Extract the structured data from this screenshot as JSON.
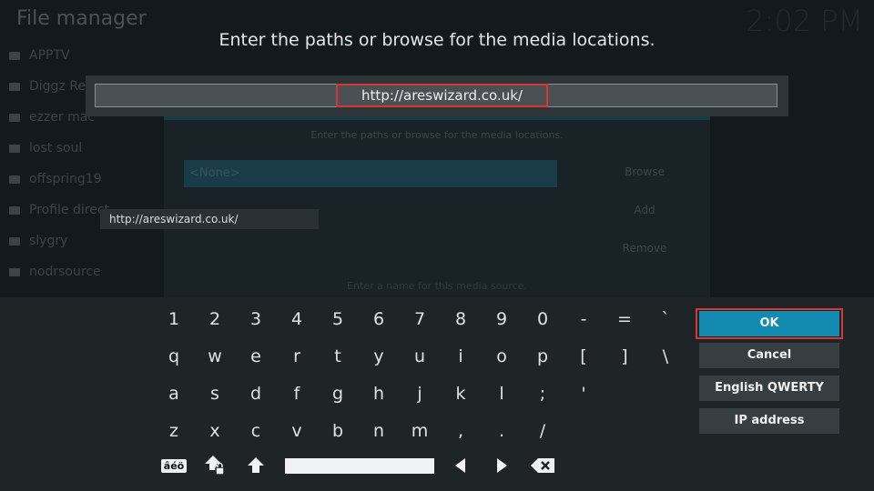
{
  "background": {
    "title": "File manager",
    "clock": "2:02 PM",
    "sources": [
      "APPTV",
      "Diggz Rep",
      "ezzer mac",
      "lost soul",
      "offspring19",
      "Profile direct",
      "slygry",
      "nodrsource"
    ],
    "dialog": {
      "subtitle": "Enter the paths or browse for the media locations.",
      "path_value": "<None>",
      "browse_label": "Browse",
      "add_label": "Add",
      "remove_label": "Remove",
      "name_prompt": "Enter a name for this media source."
    }
  },
  "keyboard_dialog": {
    "heading": "Enter the paths or browse for the media locations.",
    "input_value": "http://areswizard.co.uk/",
    "autocomplete": "http://areswizard.co.uk/",
    "rows": [
      [
        "1",
        "2",
        "3",
        "4",
        "5",
        "6",
        "7",
        "8",
        "9",
        "0",
        "-",
        "=",
        "`"
      ],
      [
        "q",
        "w",
        "e",
        "r",
        "t",
        "y",
        "u",
        "i",
        "o",
        "p",
        "[",
        "]",
        "\\"
      ],
      [
        "a",
        "s",
        "d",
        "f",
        "g",
        "h",
        "j",
        "k",
        "l",
        ";",
        "'"
      ],
      [
        "z",
        "x",
        "c",
        "v",
        "b",
        "n",
        "m",
        ",",
        ".",
        "/"
      ]
    ],
    "special_keys": {
      "symbols_label": "âéö",
      "caps_lock_icon": "caps-lock-icon",
      "shift_icon": "shift-icon",
      "left_icon": "arrow-left-icon",
      "right_icon": "arrow-right-icon",
      "backspace_icon": "backspace-icon"
    },
    "buttons": {
      "ok": "OK",
      "cancel": "Cancel",
      "layout": "English QWERTY",
      "ip": "IP address"
    }
  },
  "colors": {
    "accent": "#138bb0",
    "highlight": "#d63636"
  }
}
